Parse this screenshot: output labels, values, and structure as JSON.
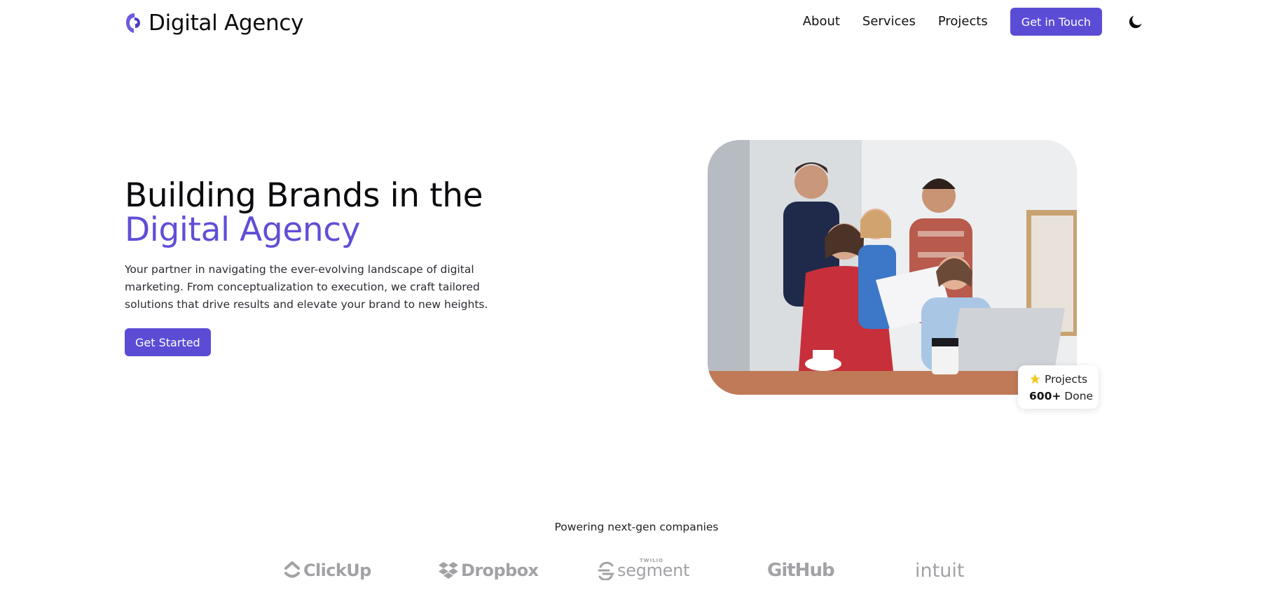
{
  "header": {
    "brand": "Digital Agency",
    "nav": {
      "about": "About",
      "services": "Services",
      "projects": "Projects",
      "cta": "Get in Touch"
    },
    "theme_icon": "moon-icon"
  },
  "hero": {
    "title_line1": "Building Brands in the",
    "title_line2": "Digital Agency",
    "description": "Your partner in navigating the ever-evolving landscape of digital marketing. From conceptualization to execution, we craft tailored solutions that drive results and elevate your brand to new heights.",
    "cta": "Get Started",
    "image_alt": "Team of four colleagues collaborating around a laptop in an office",
    "stat": {
      "icon": "star-icon",
      "label": "Projects",
      "value": "600+",
      "suffix": "Done"
    }
  },
  "partners": {
    "heading": "Powering next-gen companies",
    "companies": [
      {
        "name": "ClickUp",
        "icon": "clickup-icon"
      },
      {
        "name": "Dropbox",
        "icon": "dropbox-icon"
      },
      {
        "name": "segment",
        "kicker": "TWILIO",
        "icon": "segment-icon"
      },
      {
        "name": "GitHub",
        "icon": ""
      },
      {
        "name": "intuit",
        "icon": ""
      }
    ]
  },
  "colors": {
    "accent": "#5b4cd6",
    "text": "#0b0b0f",
    "muted_logo": "#a2a2a6"
  }
}
